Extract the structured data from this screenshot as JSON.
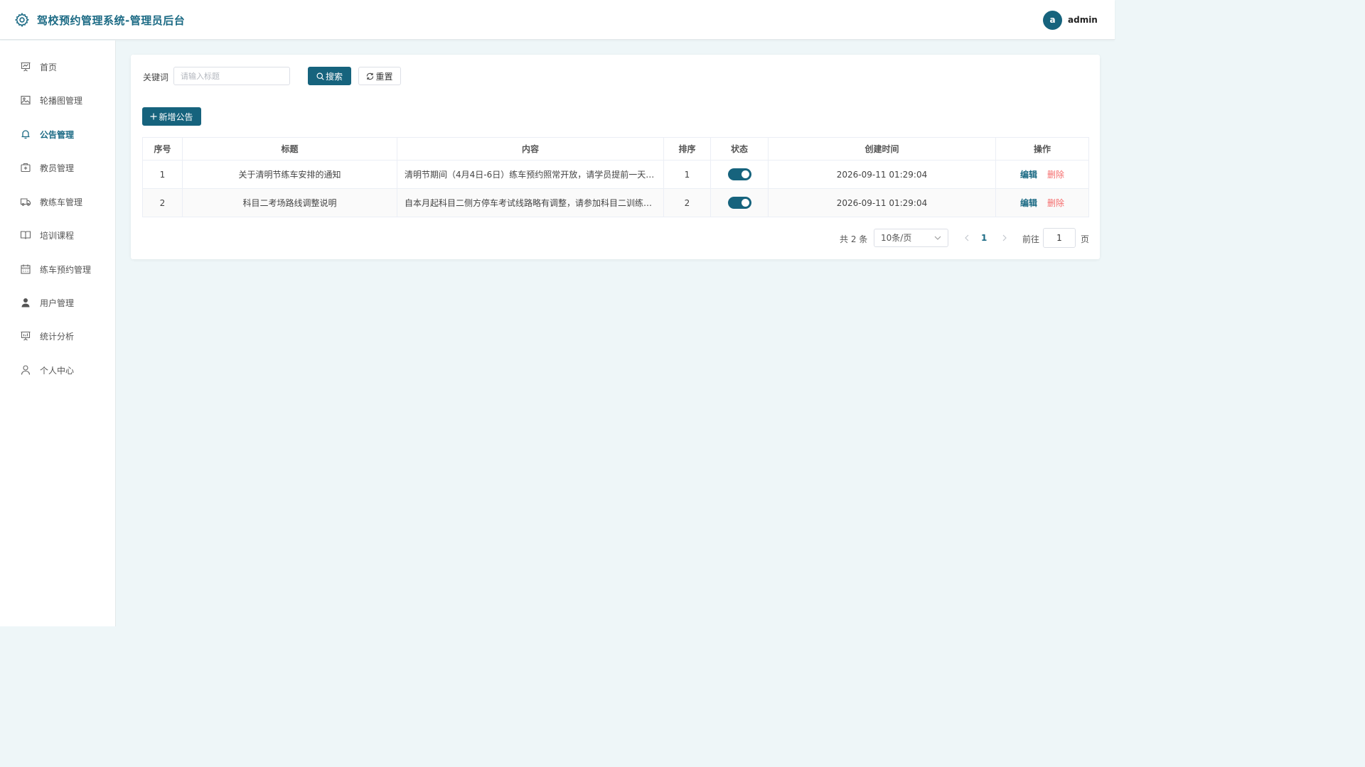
{
  "header": {
    "title": "驾校预约管理系统-管理员后台",
    "avatar_letter": "a",
    "username": "admin",
    "accent_color": "#16637d"
  },
  "sidebar": {
    "items": [
      {
        "label": "首页",
        "icon": "presentation-chart-icon",
        "active": false
      },
      {
        "label": "轮播图管理",
        "icon": "image-icon",
        "active": false
      },
      {
        "label": "公告管理",
        "icon": "bell-icon",
        "active": true
      },
      {
        "label": "教员管理",
        "icon": "first-aid-kit-icon",
        "active": false
      },
      {
        "label": "教练车管理",
        "icon": "truck-icon",
        "active": false
      },
      {
        "label": "培训课程",
        "icon": "book-open-icon",
        "active": false
      },
      {
        "label": "练车预约管理",
        "icon": "calendar-icon",
        "active": false
      },
      {
        "label": "用户管理",
        "icon": "user-filled-icon",
        "active": false
      },
      {
        "label": "统计分析",
        "icon": "data-board-icon",
        "active": false
      },
      {
        "label": "个人中心",
        "icon": "user-icon",
        "active": false
      }
    ]
  },
  "search": {
    "label": "关键词",
    "placeholder": "请输入标题",
    "value": "",
    "search_label": "搜索",
    "reset_label": "重置"
  },
  "toolbar": {
    "add_label": "新增公告"
  },
  "table": {
    "headers": [
      "序号",
      "标题",
      "内容",
      "排序",
      "状态",
      "创建时间",
      "操作"
    ],
    "rows": [
      {
        "index": "1",
        "title": "关于清明节练车安排的通知",
        "content": "清明节期间（4月4日-6日）练车预约照常开放，请学员提前一天预…",
        "sort": "1",
        "status_on": true,
        "created": "2026-09-11 01:29:04"
      },
      {
        "index": "2",
        "title": "科目二考场路线调整说明",
        "content": "自本月起科目二侧方停车考试线路略有调整，请参加科目二训练的学…",
        "sort": "2",
        "status_on": true,
        "created": "2026-09-11 01:29:04"
      }
    ],
    "edit_label": "编辑",
    "delete_label": "删除"
  },
  "pagination": {
    "total_text": "共 2 条",
    "page_size": "10条/页",
    "current_page": "1",
    "goto_label": "前往",
    "goto_value": "1",
    "page_unit": "页"
  }
}
